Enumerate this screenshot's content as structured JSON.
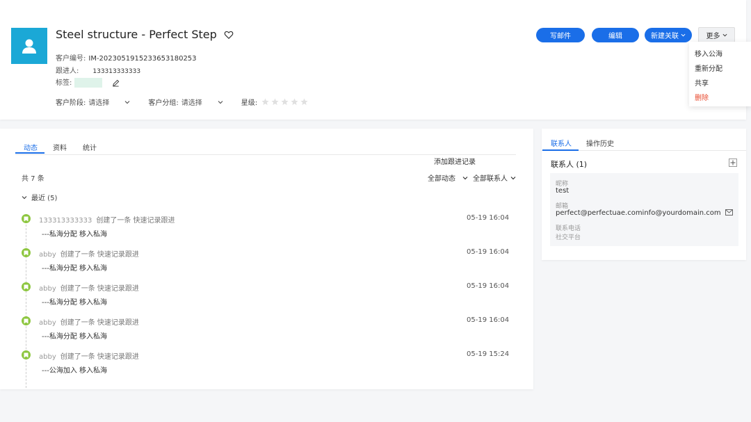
{
  "customer": {
    "title": "Steel structure - Perfect Step",
    "number_label": "客户编号:",
    "number_value": "IM-2023051915233653180253",
    "follower_label": "跟进人:",
    "follower_value": "133313333333",
    "tag_label": "标签:",
    "stage_label": "客户阶段:",
    "stage_value": "请选择",
    "group_label": "客户分组:",
    "group_value": "请选择",
    "star_label": "星级:",
    "stars_filled": 0,
    "stars_total": 5
  },
  "actions": {
    "write_email": "写邮件",
    "edit": "编辑",
    "new_link": "新建关联",
    "more": "更多"
  },
  "more_menu": {
    "items": [
      "移入公海",
      "重新分配",
      "共享",
      "删除"
    ],
    "danger_color": "#e8492d"
  },
  "left": {
    "tabs": [
      "动态",
      "资料",
      "统计"
    ],
    "add_record": "添加跟进记录",
    "count": "共 7 条",
    "filter_all_activity": "全部动态",
    "filter_all_contacts": "全部联系人",
    "group_recent": "最近 (5)",
    "entries": [
      {
        "user": "133313333333",
        "action": "创建了一条 快速记录跟进",
        "note": "---私海分配 移入私海",
        "time": "05-19 16:04"
      },
      {
        "user": "abby",
        "action": "创建了一条 快速记录跟进",
        "note": "---私海分配 移入私海",
        "time": "05-19 16:04"
      },
      {
        "user": "abby",
        "action": "创建了一条 快速记录跟进",
        "note": "---私海分配 移入私海",
        "time": "05-19 16:04"
      },
      {
        "user": "abby",
        "action": "创建了一条 快速记录跟进",
        "note": "---私海分配 移入私海",
        "time": "05-19 16:04"
      },
      {
        "user": "abby",
        "action": "创建了一条 快速记录跟进",
        "note": "---公海加入 移入私海",
        "time": "05-19 15:24"
      }
    ]
  },
  "right": {
    "tabs": [
      "联系人",
      "操作历史"
    ],
    "contacts_title": "联系人 (1)",
    "contact": {
      "nickname_label": "昵称",
      "nickname_value": "test",
      "email_label": "邮箱",
      "email_value": "perfect@perfectuae.cominfo@yourdomain.com",
      "phone_label": "联系电话",
      "social_label": "社交平台"
    }
  },
  "colors": {
    "accent": "#1a6ee8",
    "avatar_bg": "#1ba8d6",
    "timeline_icon": "#8dc63f"
  }
}
